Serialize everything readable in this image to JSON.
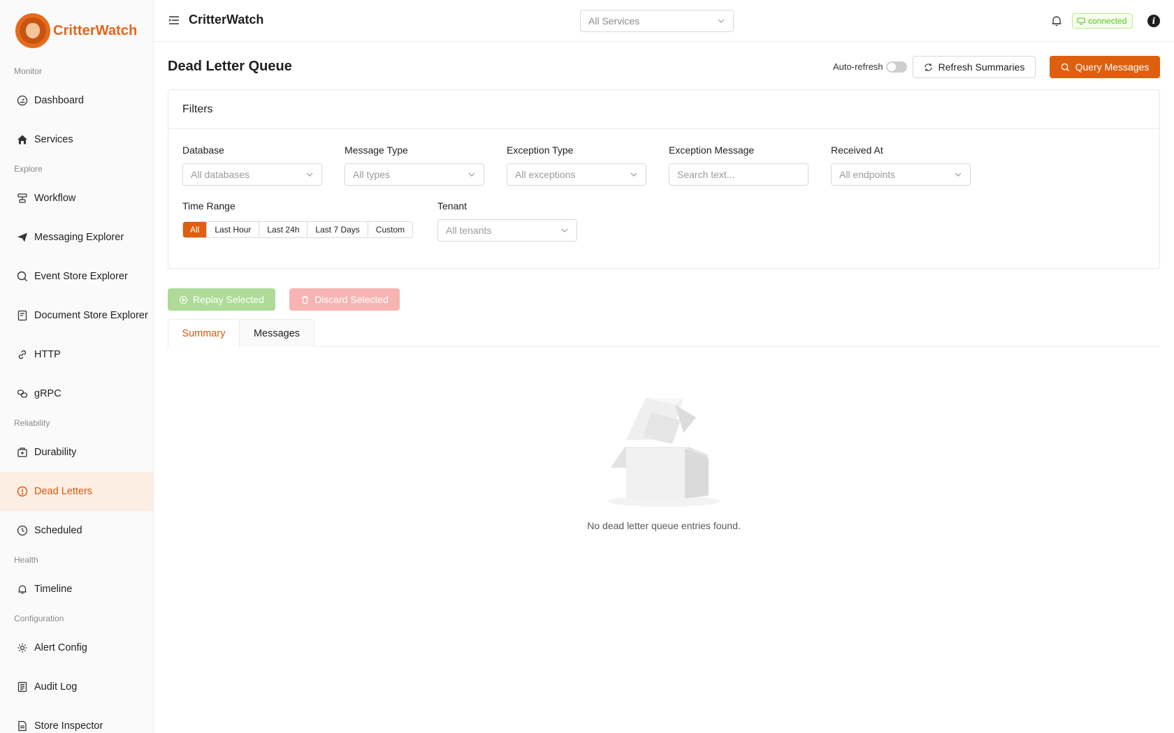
{
  "brand": {
    "name": "CritterWatch"
  },
  "sidebar": {
    "sections": [
      {
        "label": "Monitor",
        "items": [
          {
            "label": "Dashboard",
            "icon": "dashboard-icon"
          },
          {
            "label": "Services",
            "icon": "home-icon"
          }
        ]
      },
      {
        "label": "Explore",
        "items": [
          {
            "label": "Workflow",
            "icon": "workflow-icon"
          },
          {
            "label": "Messaging Explorer",
            "icon": "send-icon"
          },
          {
            "label": "Event Store Explorer",
            "icon": "search-icon"
          },
          {
            "label": "Document Store Explorer",
            "icon": "document-icon"
          },
          {
            "label": "HTTP",
            "icon": "link-icon"
          },
          {
            "label": "gRPC",
            "icon": "grpc-icon"
          }
        ]
      },
      {
        "label": "Reliability",
        "items": [
          {
            "label": "Durability",
            "icon": "durability-icon"
          },
          {
            "label": "Dead Letters",
            "icon": "alert-circle-icon",
            "active": true
          },
          {
            "label": "Scheduled",
            "icon": "clock-icon"
          }
        ]
      },
      {
        "label": "Health",
        "items": [
          {
            "label": "Timeline",
            "icon": "bell-icon"
          }
        ]
      },
      {
        "label": "Configuration",
        "items": [
          {
            "label": "Alert Config",
            "icon": "gear-icon"
          },
          {
            "label": "Audit Log",
            "icon": "log-icon"
          },
          {
            "label": "Store Inspector",
            "icon": "file-icon"
          }
        ]
      }
    ]
  },
  "header": {
    "title": "CritterWatch",
    "service_select": "All Services",
    "status": "connected",
    "status_color": "#52c41a"
  },
  "page": {
    "title": "Dead Letter Queue",
    "auto_refresh_label": "Auto-refresh",
    "auto_refresh_on": false,
    "refresh_button": "Refresh Summaries",
    "query_button": "Query Messages",
    "accent_color": "#de5f0f"
  },
  "filters": {
    "title": "Filters",
    "database": {
      "label": "Database",
      "placeholder": "All databases"
    },
    "message_type": {
      "label": "Message Type",
      "placeholder": "All types"
    },
    "exception_type": {
      "label": "Exception Type",
      "placeholder": "All exceptions"
    },
    "exception_message": {
      "label": "Exception Message",
      "placeholder": "Search text..."
    },
    "received_at": {
      "label": "Received At",
      "placeholder": "All endpoints"
    },
    "time_range": {
      "label": "Time Range",
      "options": [
        "All",
        "Last Hour",
        "Last 24h",
        "Last 7 Days",
        "Custom"
      ],
      "selected": "All"
    },
    "tenant": {
      "label": "Tenant",
      "placeholder": "All tenants"
    }
  },
  "actions": {
    "replay": "Replay Selected",
    "discard": "Discard Selected"
  },
  "tabs": [
    {
      "label": "Summary",
      "active": true
    },
    {
      "label": "Messages",
      "active": false
    }
  ],
  "empty": {
    "text": "No dead letter queue entries found."
  }
}
